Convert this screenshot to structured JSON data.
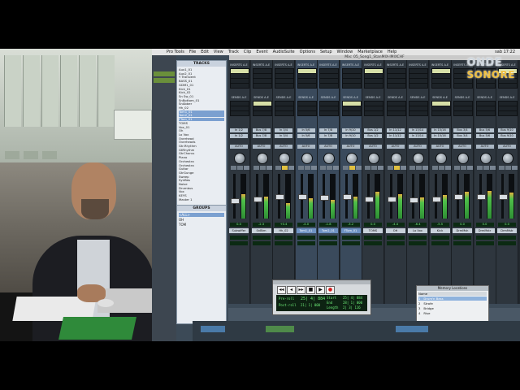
{
  "menubar": {
    "items": [
      "Pro Tools",
      "File",
      "Edit",
      "View",
      "Track",
      "Clip",
      "Event",
      "AudioSuite",
      "Options",
      "Setup",
      "Window",
      "Marketplace",
      "Help"
    ],
    "clock": "sab 17:22"
  },
  "window_title": "Mix: 05_Song1_StanMIX-IMIXCHF",
  "watermark": {
    "line1": "ONDE",
    "line2": "SONORE"
  },
  "tracks_panel": {
    "header": "TRACKS",
    "items": [
      "Aux1_01",
      "Aux2_01",
      "Y Transient",
      "BASS_01",
      "GDM1_01",
      "Kick_01",
      "Kick_02",
      "Sn Sw_01",
      "SnBottom_01",
      "SnAbber",
      "Hh_02",
      "Tom1_01",
      "Tom2_01",
      "FTom_01",
      "TOMS",
      "Vox_01",
      "Oh",
      "Lo Vox",
      "Overhead",
      "Overheads",
      "Gtr.Rhythm",
      "GtRhythm",
      "GtrChorus",
      "Piano",
      "Orchestra",
      "Orchestra",
      "Guitar",
      "GtrGunge",
      "Sweep",
      "SynBas",
      "Noise",
      "Drumbus",
      "Vox",
      "KEYS",
      "Master 1"
    ],
    "selected": [
      11,
      12,
      13
    ]
  },
  "groups_panel": {
    "header": "GROUPS",
    "items": [
      "<ALL>",
      "OH",
      "TOM"
    ],
    "selected": [
      0
    ]
  },
  "mixer": {
    "strips": [
      {
        "name": "Subwiffer",
        "io": "In 1/2",
        "auto": "AUTO",
        "vol": "0.0",
        "level": 0.55,
        "fader": 0.4,
        "solo": false
      },
      {
        "name": "SnBtm",
        "io": "Bus 7/8",
        "auto": "AUTO",
        "vol": "-2.3",
        "level": 0.5,
        "fader": 0.45,
        "solo": false
      },
      {
        "name": "Hh_02",
        "io": "In 3/4",
        "auto": "AUTO",
        "vol": "+0.4",
        "level": 0.35,
        "fader": 0.5,
        "solo": true
      },
      {
        "name": "Tom1_01",
        "io": "In 5/6",
        "auto": "AUTO",
        "vol": "-4.0",
        "level": 0.45,
        "fader": 0.5,
        "solo": false,
        "sel": true
      },
      {
        "name": "Tom2_01",
        "io": "In 7/8",
        "auto": "AUTO",
        "vol": "-1.8",
        "level": 0.42,
        "fader": 0.48,
        "solo": false,
        "sel": true
      },
      {
        "name": "FTom_01",
        "io": "In 9/10",
        "auto": "AUTO",
        "vol": "-3.2",
        "level": 0.5,
        "fader": 0.5,
        "solo": true,
        "sel": true
      },
      {
        "name": "TOMS",
        "io": "Bus 1/2",
        "auto": "AUTO",
        "vol": "0.0",
        "level": 0.6,
        "fader": 0.45,
        "solo": false
      },
      {
        "name": "OH",
        "io": "In 11/12",
        "auto": "AUTO",
        "vol": "-4.4",
        "level": 0.55,
        "fader": 0.45,
        "solo": true
      },
      {
        "name": "Lo Vox",
        "io": "In 13/14",
        "auto": "AUTO",
        "vol": "-6.4",
        "level": 0.48,
        "fader": 0.42,
        "solo": false
      },
      {
        "name": "Kick",
        "io": "In 15/16",
        "auto": "AUTO",
        "vol": "-5.5",
        "level": 0.52,
        "fader": 0.44,
        "solo": false
      },
      {
        "name": "DrmMsh",
        "io": "Bus 3/4",
        "auto": "AUTO",
        "vol": "0.0",
        "level": 0.6,
        "fader": 0.5,
        "solo": false
      },
      {
        "name": "DrmMstr",
        "io": "Bus 5/6",
        "auto": "AUTO",
        "vol": "0.0",
        "level": 0.62,
        "fader": 0.5,
        "solo": false
      },
      {
        "name": "DrmMstr",
        "io": "Bus 9/10",
        "auto": "AUTO",
        "vol": "0.0",
        "level": 0.58,
        "fader": 0.5,
        "solo": false
      }
    ]
  },
  "transport": {
    "buttons": [
      "◂◂",
      "◂",
      "▸▸",
      "■",
      "▶",
      "●"
    ],
    "labels": {
      "pre": "Pre-roll",
      "post": "Post-roll",
      "start": "Start",
      "end": "End",
      "length": "Length"
    },
    "values": {
      "main": "25| 4| 884",
      "sub": "21| 1| 000",
      "start": "25| 4| 884",
      "end": "28| 1| 000",
      "length": "2| 3| 116"
    }
  },
  "memory_locations": {
    "title": "Memory Locations",
    "header": "Name",
    "items": [
      "Drum'n Bass",
      "Strofe",
      "Bridge",
      "Rise"
    ],
    "selected": [
      0
    ]
  }
}
